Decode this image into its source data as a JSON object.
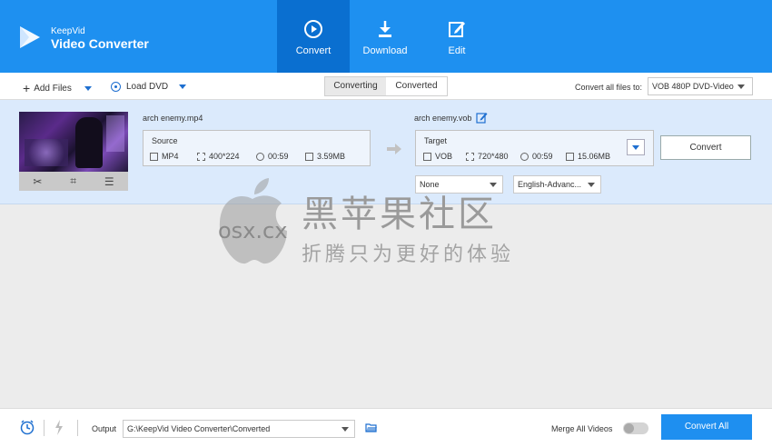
{
  "app": {
    "brand_small": "KeepVid",
    "brand_big": "Video Converter",
    "accent": "#1e90f0"
  },
  "nav": {
    "tabs": [
      {
        "label": "Convert",
        "icon": "convert-icon",
        "active": true
      },
      {
        "label": "Download",
        "icon": "download-icon",
        "active": false
      },
      {
        "label": "Edit",
        "icon": "edit-icon",
        "active": false
      }
    ]
  },
  "toolbar": {
    "add_files": "Add Files",
    "load_dvd": "Load DVD",
    "segments": [
      "Converting",
      "Converted"
    ],
    "convert_all_label": "Convert all files to:",
    "format": "VOB 480P DVD-Video"
  },
  "file": {
    "source_name": "arch enemy.mp4",
    "target_name": "arch enemy.vob",
    "source": {
      "title": "Source",
      "format": "MP4",
      "resolution": "400*224",
      "duration": "00:59",
      "size": "3.59MB"
    },
    "target": {
      "title": "Target",
      "format": "VOB",
      "resolution": "720*480",
      "duration": "00:59",
      "size": "15.06MB"
    },
    "subtitle": "None",
    "audio": "English-Advanc...",
    "convert_label": "Convert"
  },
  "watermark": {
    "site": "osx.cx",
    "line1": "黑苹果社区",
    "line2": "折腾只为更好的体验"
  },
  "bottom": {
    "output_label": "Output",
    "output_path": "G:\\KeepVid Video Converter\\Converted",
    "merge_label": "Merge All Videos",
    "convert_all_label": "Convert All"
  }
}
